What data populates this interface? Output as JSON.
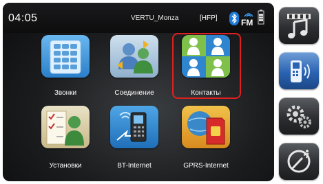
{
  "status_bar": {
    "time": "04:05",
    "device_name": "VERTU_Monza",
    "profile": "[HFP]",
    "radio": "FM",
    "icons": [
      "bluetooth-icon",
      "fm-radio-icon",
      "battery-icon"
    ]
  },
  "menu": {
    "items": [
      {
        "label": "Звонки",
        "icon": "keypad-icon"
      },
      {
        "label": "Соединение",
        "icon": "connection-icon"
      },
      {
        "label": "Контакты",
        "icon": "contacts-icon",
        "selected": true
      },
      {
        "label": "Установки",
        "icon": "settings-checklist-icon"
      },
      {
        "label": "BT-Internet",
        "icon": "bt-phone-icon"
      },
      {
        "label": "GPRS-Internet",
        "icon": "gprs-simcard-icon"
      }
    ]
  },
  "sidebar": {
    "buttons": [
      {
        "name": "media-icon"
      },
      {
        "name": "phone-icon",
        "active": true
      },
      {
        "name": "gears-icon"
      },
      {
        "name": "navigation-icon"
      }
    ]
  },
  "colors": {
    "highlight": "#e02020",
    "accent_blue": "#3a8fd6"
  }
}
